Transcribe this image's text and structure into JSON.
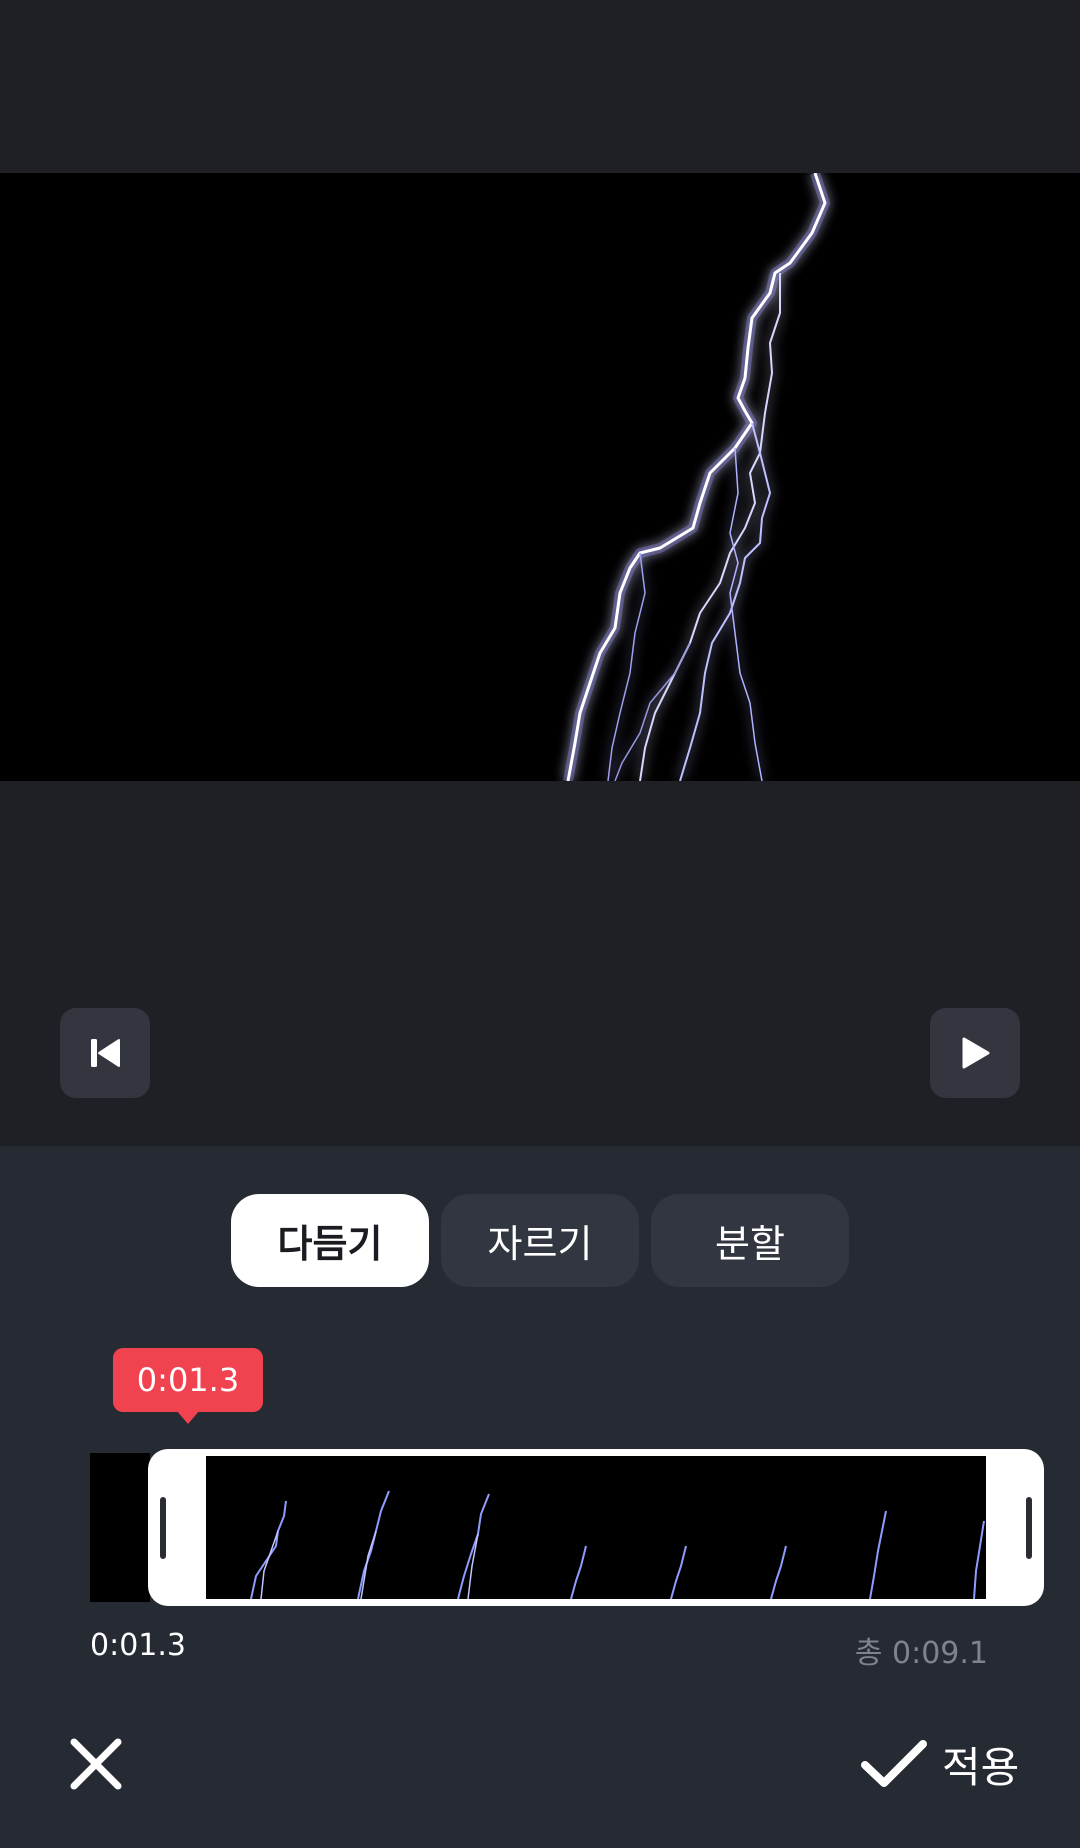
{
  "player": {
    "rewind_icon": "skip-to-start-icon",
    "play_icon": "play-icon"
  },
  "tabs": [
    {
      "label": "다듬기",
      "active": true
    },
    {
      "label": "자르기",
      "active": false
    },
    {
      "label": "분할",
      "active": false
    }
  ],
  "timeline": {
    "playhead_time": "0:01.3",
    "current_time": "0:01.3",
    "total_time": "총 0:09.1"
  },
  "actions": {
    "cancel_icon": "close-icon",
    "apply_icon": "checkmark-icon",
    "apply_label": "적용"
  },
  "colors": {
    "accent": "#f0424f",
    "panel": "#262a33",
    "background": "#1f2026"
  }
}
